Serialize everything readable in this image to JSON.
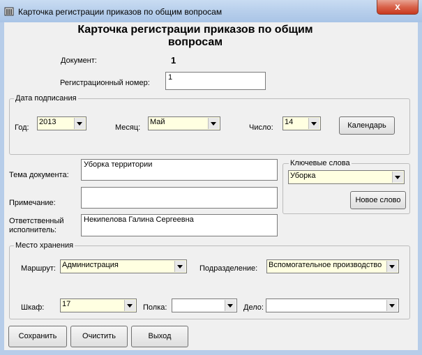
{
  "window": {
    "title": "Карточка регистрации приказов по общим вопросам",
    "close_symbol": "x",
    "icon": "app-icon"
  },
  "heading": {
    "line1": "Карточка регистрации приказов по общим",
    "line2": "вопросам"
  },
  "document": {
    "label": "Документ:",
    "value": "1"
  },
  "reg_number": {
    "label": "Регистрационный номер:",
    "value": "1"
  },
  "date_group": {
    "legend": "Дата подписания",
    "year_label": "Год:",
    "year_value": "2013",
    "month_label": "Месяц:",
    "month_value": "Май",
    "day_label": "Число:",
    "day_value": "14",
    "calendar_button": "Календарь"
  },
  "topic": {
    "label": "Тема документа:",
    "value": "Уборка территории"
  },
  "note": {
    "label": "Примечание:",
    "value": ""
  },
  "executor": {
    "label_line1": "Ответственный",
    "label_line2": "исполнитель:",
    "value": "Некипелова Галина Сергеевна"
  },
  "keywords": {
    "legend": "Ключевые слова",
    "value": "Уборка",
    "new_button": "Новое слово"
  },
  "storage_group": {
    "legend": "Место хранения",
    "route_label": "Маршрут:",
    "route_value": "Администрация",
    "division_label": "Подразделение:",
    "division_value": "Вспомогательное производство",
    "cabinet_label": "Шкаф:",
    "cabinet_value": "17",
    "shelf_label": "Полка:",
    "shelf_value": "",
    "case_label": "Дело:",
    "case_value": ""
  },
  "buttons": {
    "save": "Сохранить",
    "clear": "Очистить",
    "exit": "Выход"
  },
  "colors": {
    "combo_bg": "#ffffe1",
    "titlebar": "#b9d0ec",
    "close": "#d9634b"
  }
}
